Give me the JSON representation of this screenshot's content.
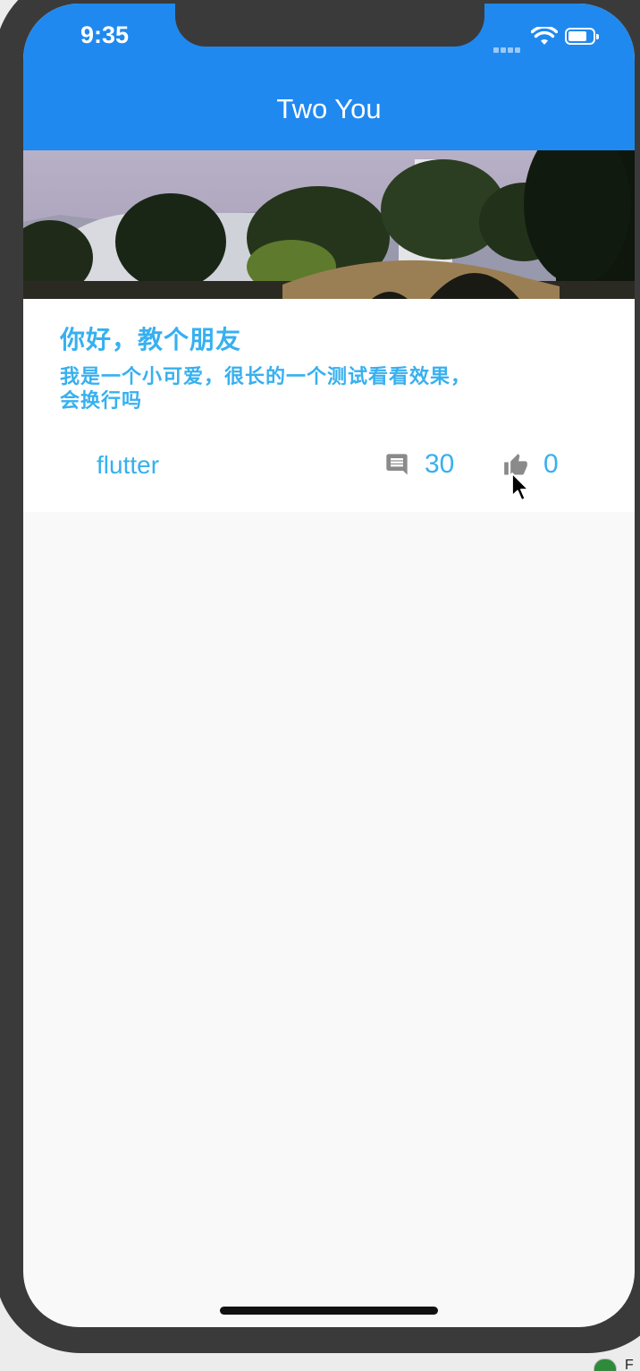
{
  "status_bar": {
    "time": "9:35"
  },
  "app_bar": {
    "title": "Two You"
  },
  "card": {
    "title": "你好，教个朋友",
    "description": "我是一个小可爱，很长的一个测试看看效果，会换行吗",
    "tag": "flutter",
    "comments": "30",
    "likes": "0",
    "comment_icon": "comment-icon",
    "like_icon": "thumb-up-icon"
  },
  "taskbar": {
    "partial_label": "F"
  },
  "colors": {
    "app_bar": "#2089ef",
    "accent_text": "#37b0f0",
    "icon_gray": "#8a8a8a",
    "device_frame": "#3b3a3a"
  }
}
